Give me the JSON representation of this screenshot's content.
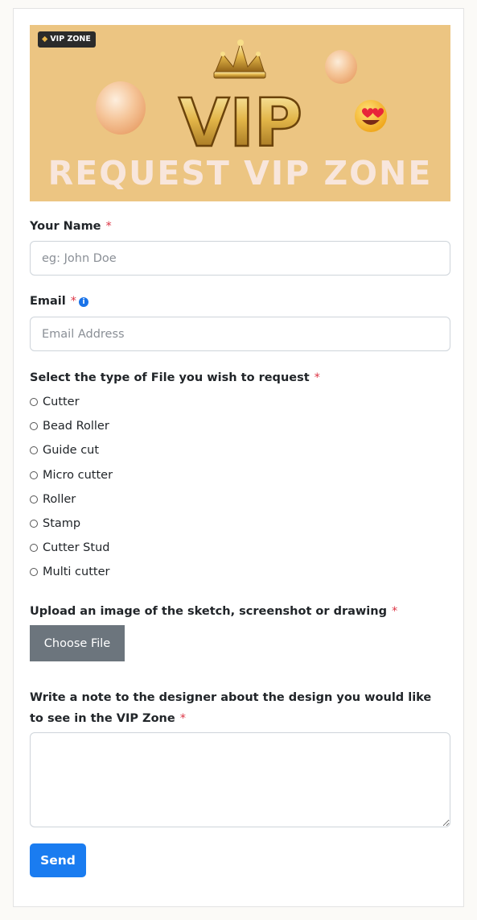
{
  "banner": {
    "badge": "VIP ZONE",
    "logo_text": "VIP",
    "title": "REQUEST VIP ZONE"
  },
  "form": {
    "name": {
      "label": "Your Name",
      "required": "*",
      "placeholder": "eg: John Doe",
      "value": ""
    },
    "email": {
      "label": "Email",
      "required": "*",
      "info_icon": "info-icon",
      "placeholder": "Email Address",
      "value": ""
    },
    "file_type": {
      "label": "Select the type of File you wish to request",
      "required": "*",
      "options": [
        "Cutter",
        "Bead Roller",
        "Guide cut",
        "Micro cutter",
        "Roller",
        "Stamp",
        "Cutter Stud",
        "Multi cutter"
      ],
      "selected": null
    },
    "upload": {
      "label": "Upload an image of the sketch, screenshot or drawing",
      "required": "*",
      "button": "Choose File"
    },
    "note": {
      "label": "Write a note to the designer about the design you would like to see in the VIP Zone",
      "required": "*",
      "value": ""
    },
    "submit": "Send"
  },
  "colors": {
    "banner_bg": "#ecc582",
    "accent": "#1a7cf0",
    "required": "#dc3545",
    "choose_button": "#6c757d"
  }
}
